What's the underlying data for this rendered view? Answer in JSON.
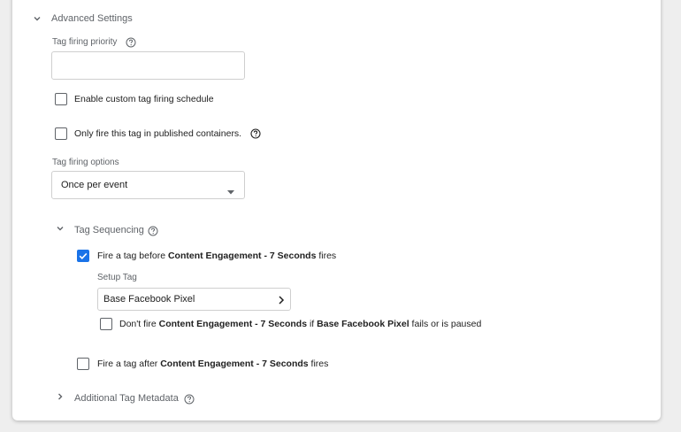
{
  "advanced": {
    "title": "Advanced Settings",
    "priority_label": "Tag firing priority",
    "priority_value": "",
    "custom_schedule_label": "Enable custom tag firing schedule",
    "published_only_label": "Only fire this tag in published containers.",
    "firing_options_label": "Tag firing options",
    "firing_options_value": "Once per event"
  },
  "sequencing": {
    "title": "Tag Sequencing",
    "before": {
      "checked": true,
      "prefix": "Fire a tag before ",
      "tag": "Content Engagement - 7 Seconds",
      "suffix": " fires"
    },
    "setup_tag_label": "Setup Tag",
    "setup_tag_value": "Base Facebook Pixel",
    "dont_fire": {
      "checked": false,
      "part1": "Don't fire ",
      "tag": "Content Engagement - 7 Seconds",
      "part2": " if ",
      "setup": "Base Facebook Pixel",
      "part3": " fails or is paused"
    },
    "after": {
      "checked": false,
      "prefix": "Fire a tag after ",
      "tag": "Content Engagement - 7 Seconds",
      "suffix": " fires"
    }
  },
  "metadata": {
    "title": "Additional Tag Metadata"
  },
  "colors": {
    "accent": "#1a73e8",
    "secondary_text": "#5f6368"
  }
}
